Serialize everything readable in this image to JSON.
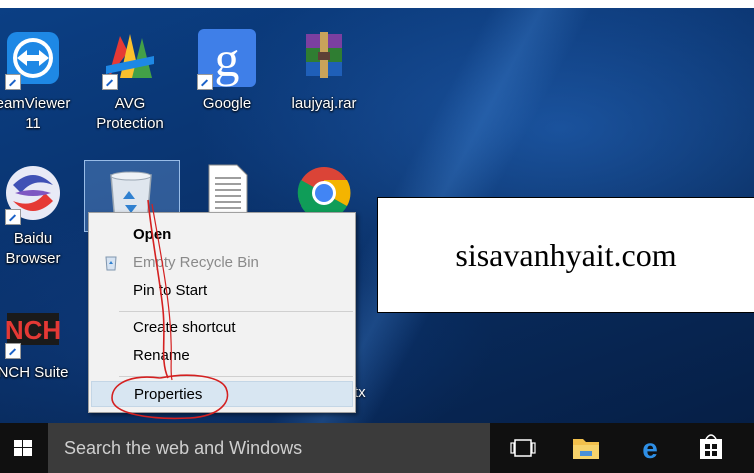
{
  "desktop_icons": [
    {
      "id": "teamviewer",
      "lines": [
        "eamViewer",
        "11"
      ]
    },
    {
      "id": "avg",
      "lines": [
        "AVG",
        "Protection"
      ]
    },
    {
      "id": "google",
      "lines": [
        "Google"
      ]
    },
    {
      "id": "rar",
      "lines": [
        "laujyaj.rar"
      ]
    },
    {
      "id": "baidu",
      "lines": [
        "Baidu",
        "Browser"
      ]
    },
    {
      "id": "nch",
      "lines": [
        "NCH Suite"
      ]
    }
  ],
  "partial_label": "tx",
  "context_menu": {
    "open": "Open",
    "empty_recycle_bin": "Empty Recycle Bin",
    "pin_to_start": "Pin to Start",
    "create_shortcut": "Create shortcut",
    "rename": "Rename",
    "properties": "Properties"
  },
  "banner": {
    "text": "sisavanhyait.com"
  },
  "taskbar": {
    "search_placeholder": "Search the web and Windows",
    "icons": [
      "task-view-icon",
      "file-explorer-icon",
      "edge-icon",
      "store-icon"
    ]
  },
  "colors": {
    "desktop": "#0a3470",
    "menu_bg": "#f2f2f2",
    "highlight": "#d8e6f2",
    "annotation": "#d42020"
  }
}
